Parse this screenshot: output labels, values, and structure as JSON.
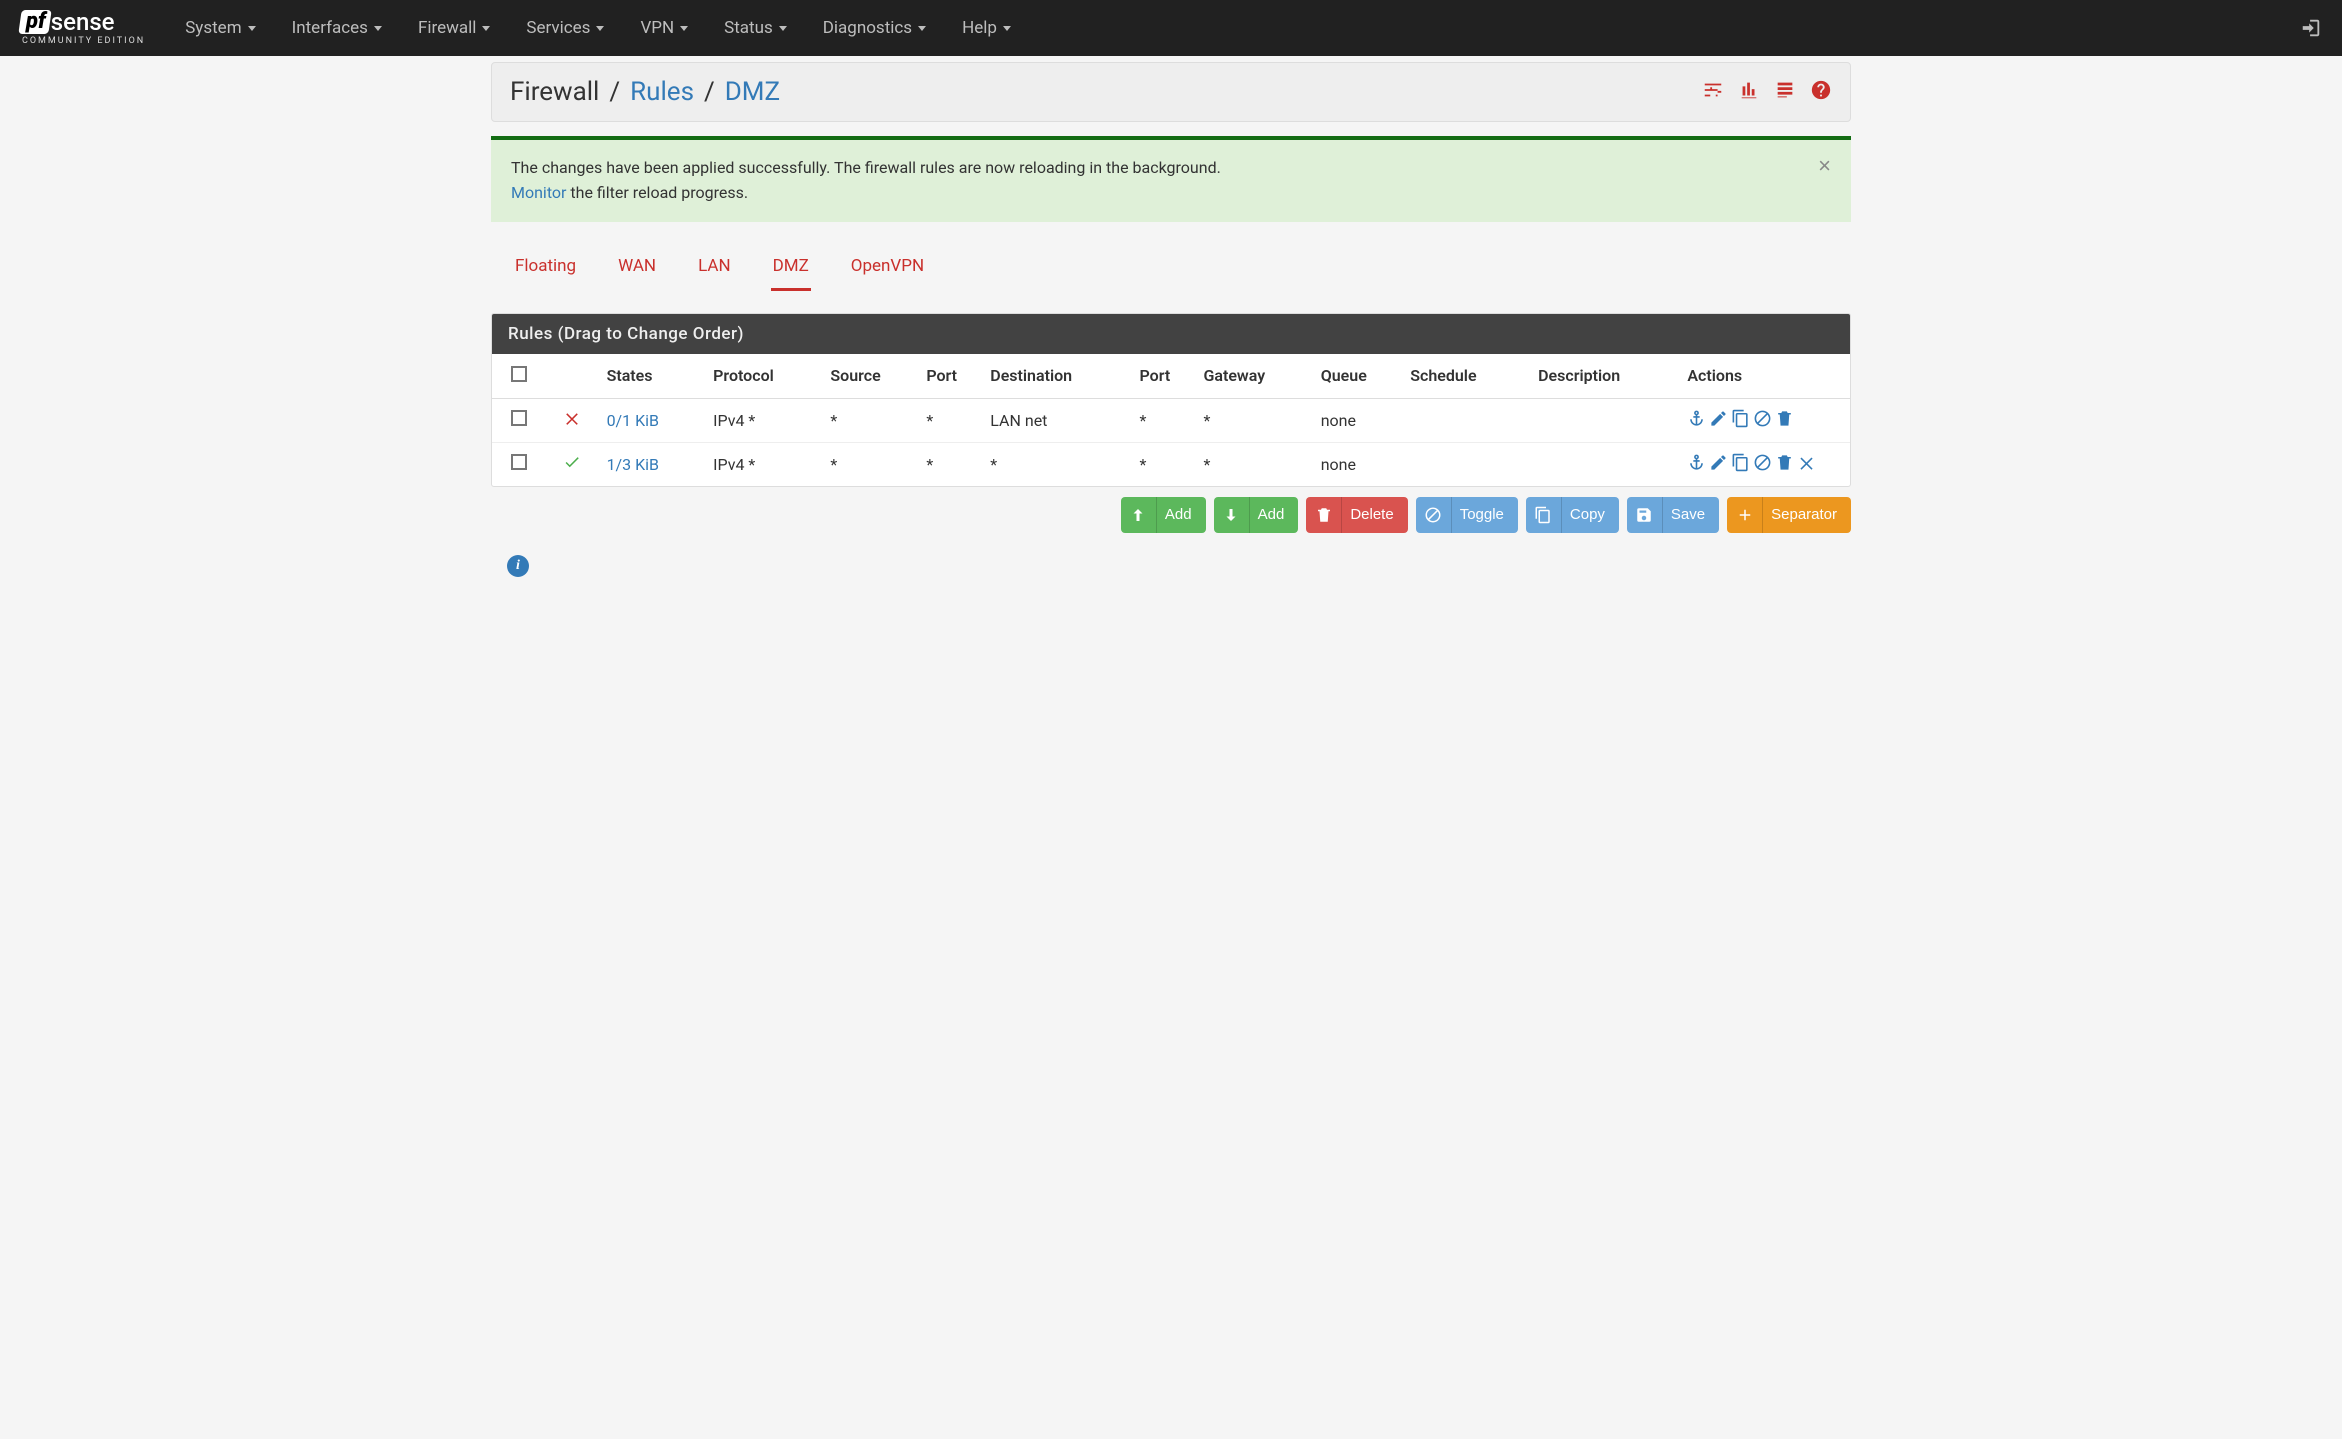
{
  "brand": {
    "box": "pf",
    "name": "sense",
    "sub": "COMMUNITY EDITION"
  },
  "nav": {
    "items": [
      "System",
      "Interfaces",
      "Firewall",
      "Services",
      "VPN",
      "Status",
      "Diagnostics",
      "Help"
    ]
  },
  "breadcrumb": {
    "root": "Firewall",
    "mid": "Rules",
    "leaf": "DMZ"
  },
  "alert": {
    "line1": "The changes have been applied successfully. The firewall rules are now reloading in the background.",
    "monitor_link": "Monitor",
    "line2_suffix": " the filter reload progress."
  },
  "tabs": [
    "Floating",
    "WAN",
    "LAN",
    "DMZ",
    "OpenVPN"
  ],
  "tabs_active": "DMZ",
  "rules": {
    "title": "Rules (Drag to Change Order)",
    "columns": [
      "",
      "",
      "States",
      "Protocol",
      "Source",
      "Port",
      "Destination",
      "Port",
      "Gateway",
      "Queue",
      "Schedule",
      "Description",
      "Actions"
    ],
    "rows": [
      {
        "flag": "block",
        "states": "0/1 KiB",
        "protocol": "IPv4 *",
        "source": "*",
        "sport": "*",
        "dest": "LAN net",
        "dport": "*",
        "gateway": "*",
        "queue": "none",
        "schedule": "",
        "description": "",
        "show_x": false
      },
      {
        "flag": "pass",
        "states": "1/3 KiB",
        "protocol": "IPv4 *",
        "source": "*",
        "sport": "*",
        "dest": "*",
        "dport": "*",
        "gateway": "*",
        "queue": "none",
        "schedule": "",
        "description": "",
        "show_x": true
      }
    ]
  },
  "buttons": {
    "add_top": "Add",
    "add_bottom": "Add",
    "delete": "Delete",
    "toggle": "Toggle",
    "copy": "Copy",
    "save": "Save",
    "separator": "Separator"
  }
}
